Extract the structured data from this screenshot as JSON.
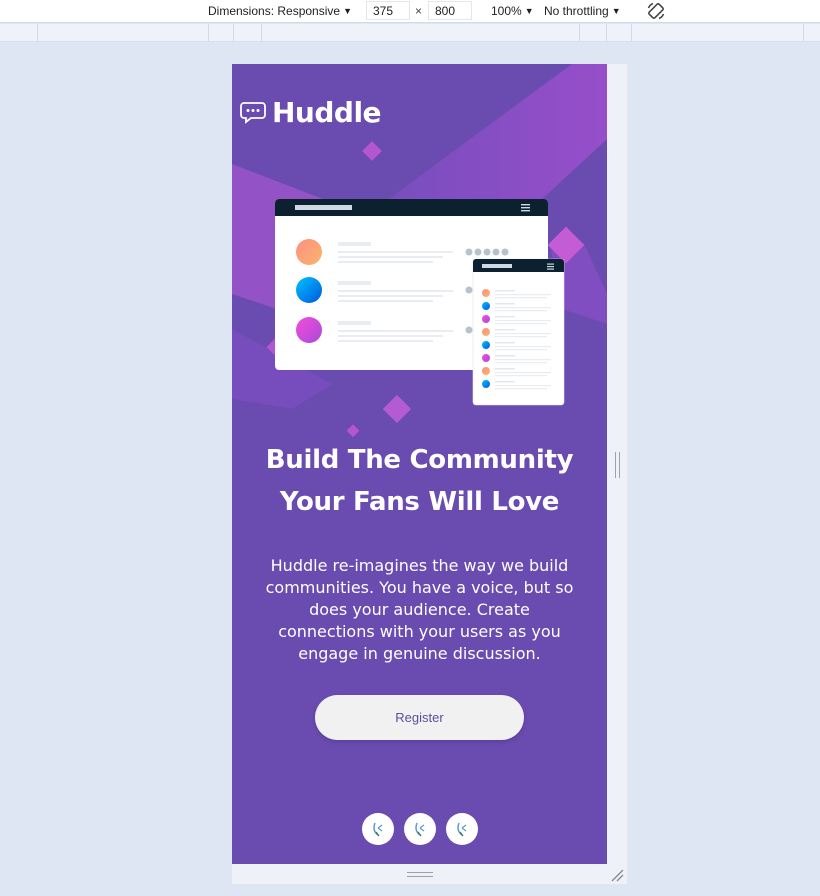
{
  "devtools": {
    "dimensions_label": "Dimensions: Responsive",
    "width_value": "375",
    "times": "×",
    "height_value": "800",
    "zoom": "100%",
    "throttling": "No throttling"
  },
  "page": {
    "logo_text": "Huddle",
    "headline_line1": "Build The Community",
    "headline_line2": "Your Fans Will Love",
    "lede": "Huddle re-imagines the way we build communities. You have a voice, but so does your audience. Create connections with your users as you engage in genuine discussion.",
    "register_label": "Register",
    "social_icons": [
      "social-link-icon",
      "social-link-icon",
      "social-link-icon"
    ]
  },
  "colors": {
    "background": "#6a4bb0",
    "accent_pink": "#c553d4",
    "button_bg": "#f1f1f1",
    "button_text": "#5a4f9e",
    "mockup_header": "#0b2130"
  }
}
